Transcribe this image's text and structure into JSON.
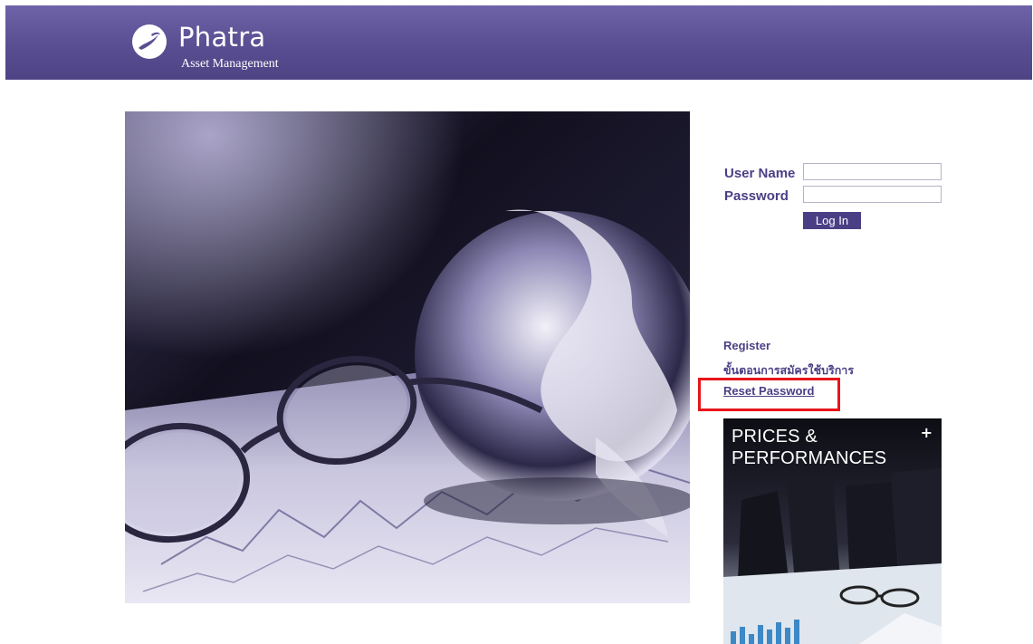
{
  "header": {
    "brand_name": "Phatra",
    "brand_subtitle": "Asset Management",
    "logo_icon": "phatra-logo-icon"
  },
  "hero": {
    "image_icon": "globe-glasses-photo"
  },
  "login": {
    "username_label": "User Name",
    "password_label": "Password",
    "username_value": "",
    "password_value": "",
    "login_button": "Log In"
  },
  "links": {
    "register": "Register",
    "registration_steps": "ขั้นตอนการสมัครใช้บริการ",
    "reset_password": "Reset Password"
  },
  "promo": {
    "title": "PRICES &\nPERFORMANCES",
    "plus": "+",
    "image_icon": "business-meeting-photo"
  },
  "colors": {
    "brand_purple": "#4a3f85",
    "header_purple": "#5a4e92",
    "highlight_red": "#e8141a"
  }
}
